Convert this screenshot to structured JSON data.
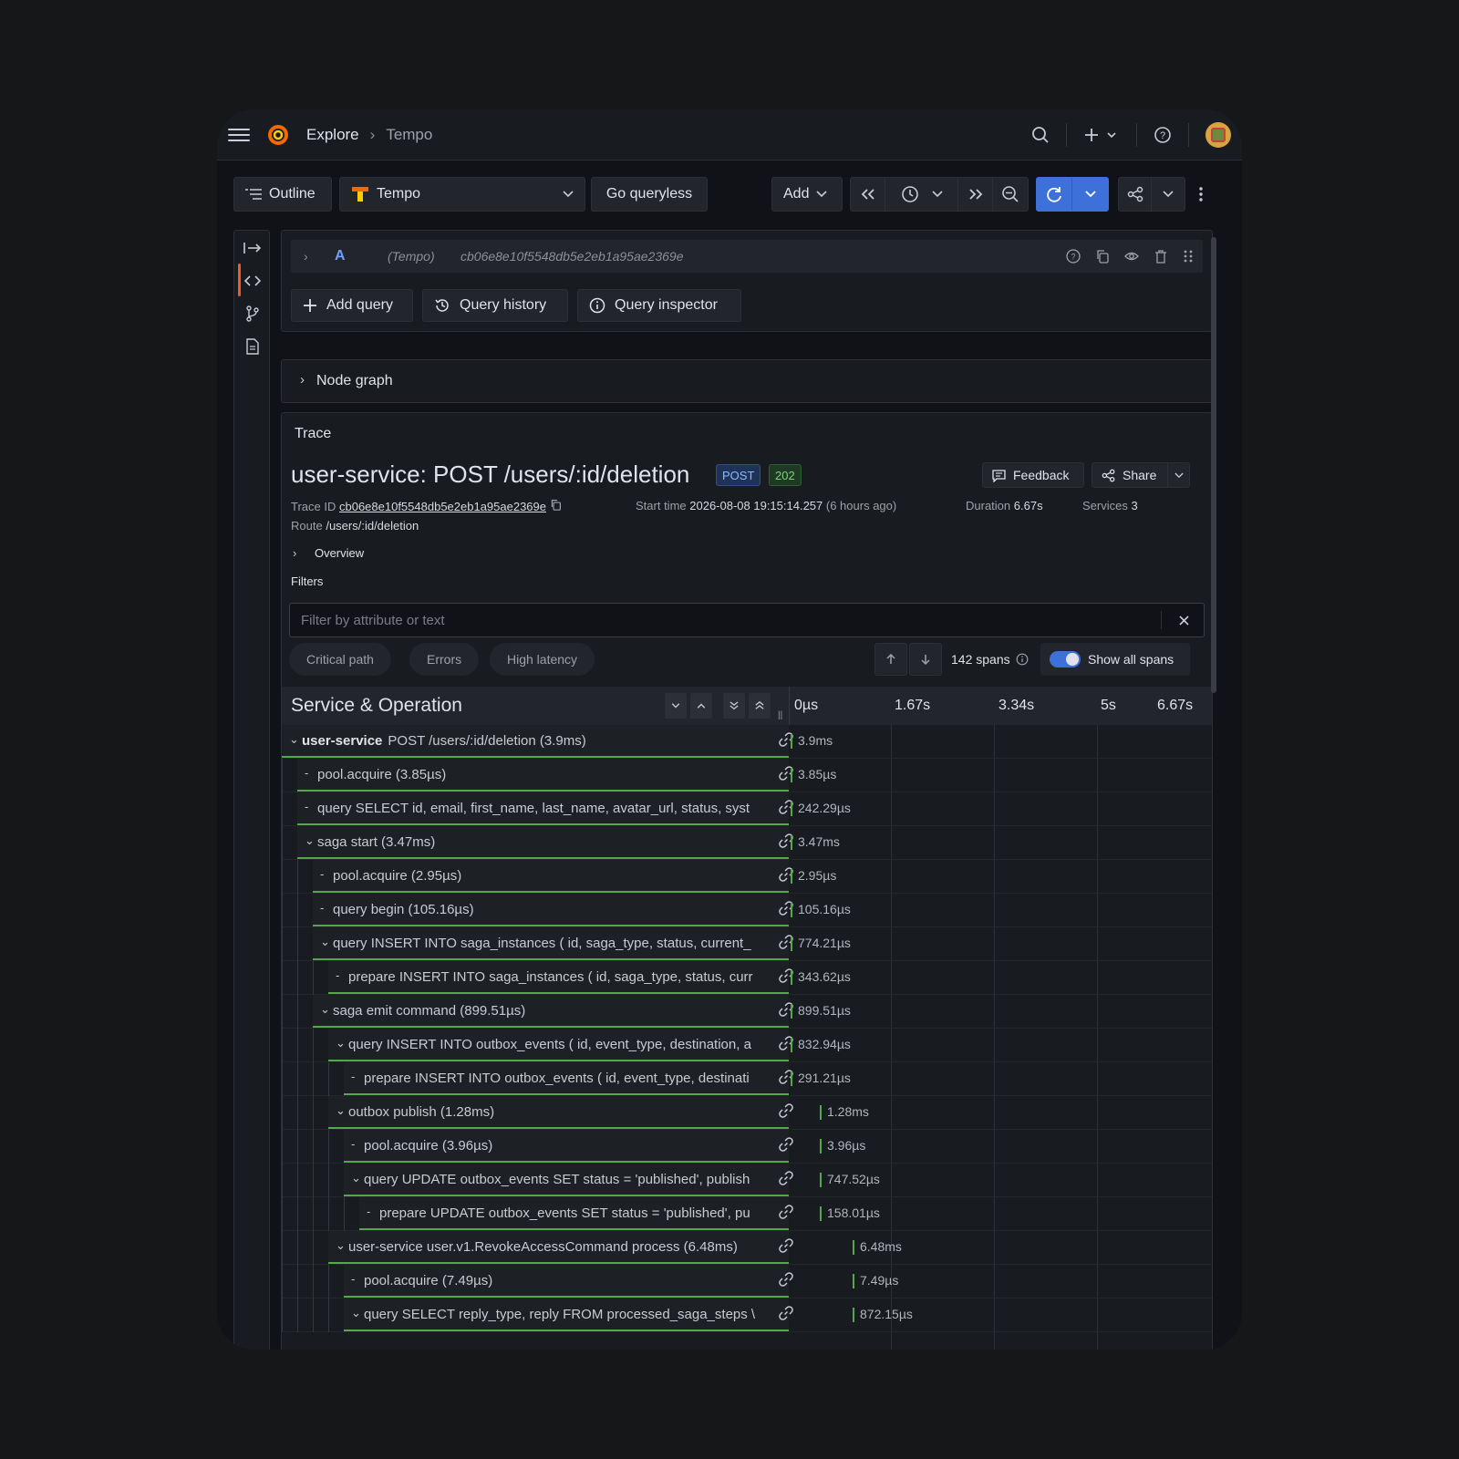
{
  "nav": {
    "breadcrumb_1": "Explore",
    "breadcrumb_sep": "›",
    "breadcrumb_2": "Tempo"
  },
  "toolbar": {
    "outline_label": "Outline",
    "datasource": "Tempo",
    "go_queryless_label": "Go queryless",
    "add_label": "Add"
  },
  "query": {
    "letter": "A",
    "datasource": "(Tempo)",
    "trace_id": "cb06e8e10f5548db5e2eb1a95ae2369e",
    "add_query_label": "Add query",
    "history_label": "Query history",
    "inspector_label": "Query inspector"
  },
  "node_graph": {
    "label": "Node graph"
  },
  "trace": {
    "section_label": "Trace",
    "title": "user-service: POST /users/:id/deletion",
    "method_badge": "POST",
    "status_badge": "202",
    "feedback_label": "Feedback",
    "share_label": "Share",
    "trace_id_label": "Trace ID",
    "trace_id": "cb06e8e10f5548db5e2eb1a95ae2369e",
    "start_label": "Start time",
    "start_value": "2026-08-08 19:15:14.257",
    "start_rel": "(6 hours ago)",
    "duration_label": "Duration",
    "duration_value": "6.67s",
    "services_label": "Services",
    "services_value": "3",
    "route_label": "Route",
    "route_value": "/users/:id/deletion",
    "overview_label": "Overview",
    "filters_label": "Filters",
    "filter_placeholder": "Filter by attribute or text",
    "pill_critical": "Critical path",
    "pill_errors": "Errors",
    "pill_latency": "High latency",
    "span_count": "142 spans",
    "show_all_label": "Show all spans",
    "col_header": "Service & Operation",
    "ticks": [
      "0µs",
      "1.67s",
      "3.34s",
      "5s",
      "6.67s"
    ]
  },
  "spans": [
    {
      "depth": 0,
      "toggle": "⌄",
      "service": "user-service",
      "label": "POST /users/:id/deletion (3.9ms)",
      "dur": "3.9ms",
      "offset": 0
    },
    {
      "depth": 1,
      "toggle": "-",
      "label": "pool.acquire (3.85µs)",
      "dur": "3.85µs",
      "offset": 0
    },
    {
      "depth": 1,
      "toggle": "-",
      "label": "query SELECT id, email, first_name, last_name, avatar_url, status, syst",
      "dur": "242.29µs",
      "offset": 0
    },
    {
      "depth": 1,
      "toggle": "⌄",
      "label": "saga start (3.47ms)",
      "dur": "3.47ms",
      "offset": 0
    },
    {
      "depth": 2,
      "toggle": "-",
      "label": "pool.acquire (2.95µs)",
      "dur": "2.95µs",
      "offset": 0
    },
    {
      "depth": 2,
      "toggle": "-",
      "label": "query begin (105.16µs)",
      "dur": "105.16µs",
      "offset": 0
    },
    {
      "depth": 2,
      "toggle": "⌄",
      "label": "query INSERT INTO saga_instances ( id, saga_type, status, current_",
      "dur": "774.21µs",
      "offset": 0
    },
    {
      "depth": 3,
      "toggle": "-",
      "label": "prepare INSERT INTO saga_instances ( id, saga_type, status, curr",
      "dur": "343.62µs",
      "offset": 0
    },
    {
      "depth": 2,
      "toggle": "⌄",
      "label": "saga emit command (899.51µs)",
      "dur": "899.51µs",
      "offset": 0
    },
    {
      "depth": 3,
      "toggle": "⌄",
      "label": "query INSERT INTO outbox_events ( id, event_type, destination, a",
      "dur": "832.94µs",
      "offset": 0
    },
    {
      "depth": 4,
      "toggle": "-",
      "label": "prepare INSERT INTO outbox_events ( id, event_type, destinati",
      "dur": "291.21µs",
      "offset": 0
    },
    {
      "depth": 3,
      "toggle": "⌄",
      "label": "outbox publish (1.28ms)",
      "dur": "1.28ms",
      "offset": 1
    },
    {
      "depth": 4,
      "toggle": "-",
      "label": "pool.acquire (3.96µs)",
      "dur": "3.96µs",
      "offset": 1
    },
    {
      "depth": 4,
      "toggle": "⌄",
      "label": "query UPDATE outbox_events SET status = 'published', publish",
      "dur": "747.52µs",
      "offset": 1
    },
    {
      "depth": 5,
      "toggle": "-",
      "label": "prepare UPDATE outbox_events SET status = 'published', pu",
      "dur": "158.01µs",
      "offset": 1
    },
    {
      "depth": 3,
      "toggle": "⌄",
      "label": "user-service user.v1.RevokeAccessCommand process (6.48ms)",
      "dur": "6.48ms",
      "offset": 2
    },
    {
      "depth": 4,
      "toggle": "-",
      "label": "pool.acquire (7.49µs)",
      "dur": "7.49µs",
      "offset": 2
    },
    {
      "depth": 4,
      "toggle": "⌄",
      "label": "query SELECT reply_type, reply FROM processed_saga_steps \\",
      "dur": "872.15µs",
      "offset": 2
    }
  ],
  "colors": {
    "accent": "#3d71d9",
    "span_bar": "#56a64b",
    "brand": "#f05a28"
  }
}
